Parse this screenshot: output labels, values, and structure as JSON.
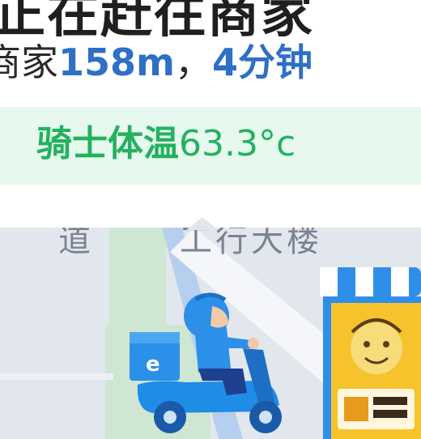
{
  "header": {
    "title_cropped": "正在赶往商家",
    "eta_prefix": "商家",
    "distance": "158m",
    "separator": "，",
    "time": "4分钟"
  },
  "temperature": {
    "label": "骑士体温",
    "value": "63.3°c"
  },
  "map": {
    "road_label": "道",
    "building_label": "工行大楼"
  },
  "colors": {
    "accent_blue": "#2f6fc6",
    "temp_green": "#24b160",
    "temp_strip_bg": "#e7f8ee",
    "map_bg": "#e2e7ee",
    "rider_blue": "#1f8ce6",
    "shop_yellow": "#f6c32c"
  },
  "icons": {
    "rider": "delivery-rider-scooter-icon",
    "shop": "shop-marker-icon"
  }
}
